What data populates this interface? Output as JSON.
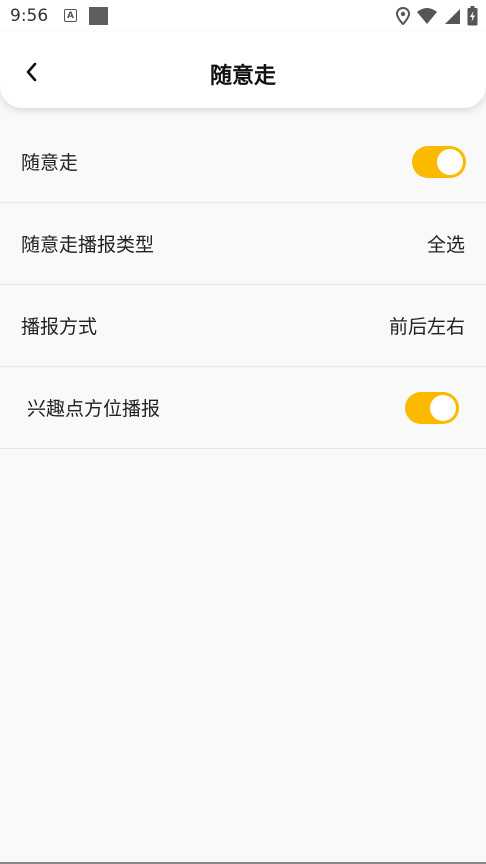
{
  "status_bar": {
    "time": "9:56",
    "notification_icon_letter": "A",
    "icons": [
      "location-icon",
      "wifi-icon",
      "signal-icon",
      "battery-charging-icon"
    ]
  },
  "header": {
    "back_icon": "chevron-left-icon",
    "title": "随意走"
  },
  "settings": [
    {
      "label": "随意走",
      "type": "toggle",
      "enabled": true
    },
    {
      "label": "随意走播报类型",
      "type": "value",
      "value": "全选"
    },
    {
      "label": "播报方式",
      "type": "value",
      "value": "前后左右"
    },
    {
      "label": "兴趣点方位播报",
      "type": "toggle",
      "enabled": true
    }
  ],
  "colors": {
    "accent": "#fbb900",
    "background": "#f9f9f9",
    "header_background": "#ffffff"
  }
}
